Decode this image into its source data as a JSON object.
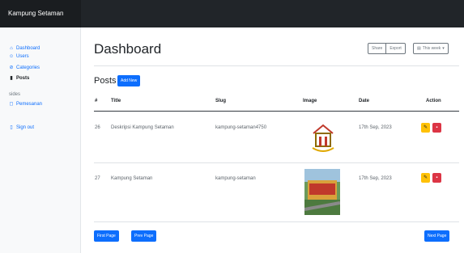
{
  "app": {
    "brand": "Kampung Setaman"
  },
  "sidebar": {
    "items": [
      {
        "label": "Dashboard",
        "icon": "home-icon"
      },
      {
        "label": "Users",
        "icon": "users-icon"
      },
      {
        "label": "Categories",
        "icon": "tag-icon"
      },
      {
        "label": "Posts",
        "icon": "file-icon",
        "active": true
      }
    ],
    "heading": "sides",
    "sub_items": [
      {
        "label": "Pemesanan",
        "icon": "file-icon"
      }
    ],
    "signout": {
      "label": "Sign out",
      "icon": "signout-icon"
    }
  },
  "header": {
    "title": "Dashboard",
    "share_label": "Share",
    "export_label": "Export",
    "week_label": "This week"
  },
  "posts": {
    "heading": "Posts",
    "add_label": "Add New",
    "columns": [
      "#",
      "Title",
      "Slug",
      "Image",
      "Date",
      "Action"
    ],
    "rows": [
      {
        "id": "26",
        "title": "Deskripsi Kampung Setaman",
        "slug": "kampung-setaman4750",
        "date": "17th Sep, 2023"
      },
      {
        "id": "27",
        "title": "Kampung Setaman",
        "slug": "kampung-setaman",
        "date": "17th Sep, 2023"
      }
    ]
  },
  "pagination": {
    "first_label": "First Page",
    "prev_label": "Prev Page",
    "next_label": "Next Page"
  },
  "colors": {
    "primary": "#0d6efd",
    "warning": "#ffc107",
    "danger": "#dc3545",
    "topbar": "#212529"
  }
}
